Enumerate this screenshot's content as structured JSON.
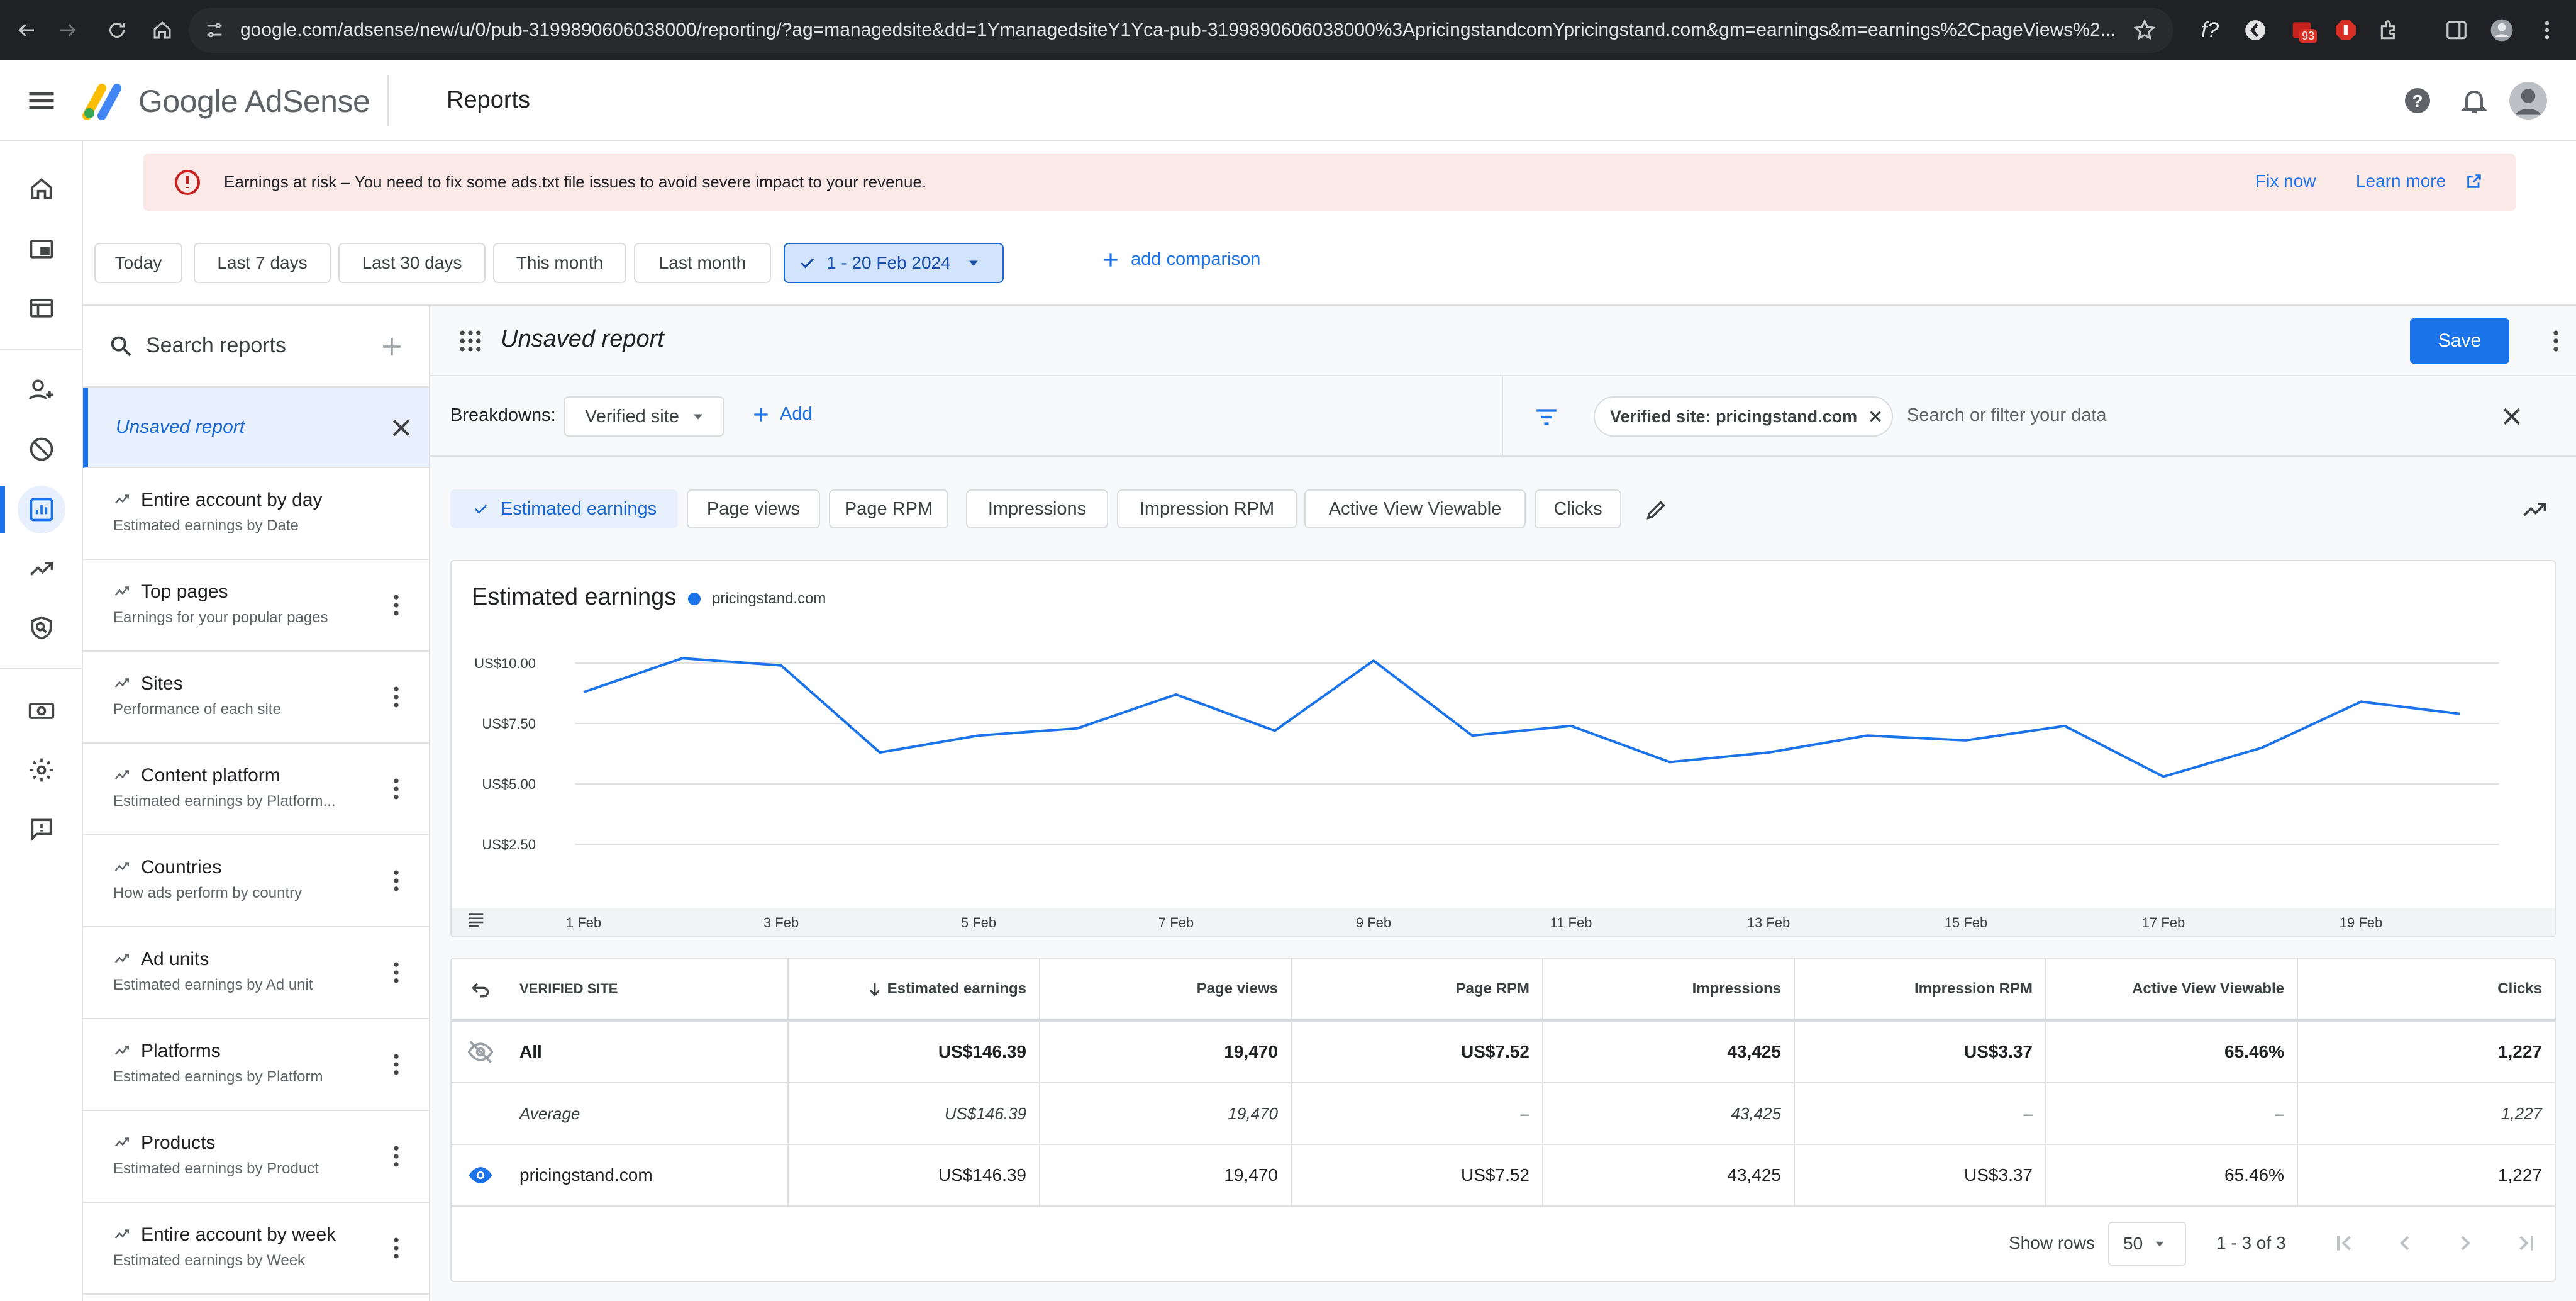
{
  "browser": {
    "url": "google.com/adsense/new/u/0/pub-3199890606038000/reporting/?ag=managedsite&dd=1YmanagedsiteY1Yca-pub-3199890606038000%3ApricingstandcomYpricingstand.com&gm=earnings&m=earnings%2CpageViews%2...",
    "extension_badge": "93"
  },
  "app": {
    "brand": "Google AdSense",
    "page_title": "Reports"
  },
  "banner": {
    "message": "Earnings at risk – You need to fix some ads.txt file issues to avoid severe impact to your revenue.",
    "fix_now": "Fix now",
    "learn_more": "Learn more"
  },
  "date_range": {
    "chips": [
      "Today",
      "Last 7 days",
      "Last 30 days",
      "This month",
      "Last month"
    ],
    "selected": "1 - 20 Feb 2024",
    "add_comparison": "add comparison"
  },
  "report_list": {
    "search_placeholder": "Search reports",
    "current": "Unsaved report",
    "items": [
      {
        "title": "Entire account by day",
        "subtitle": "Estimated earnings by Date"
      },
      {
        "title": "Top pages",
        "subtitle": "Earnings for your popular pages"
      },
      {
        "title": "Sites",
        "subtitle": "Performance of each site"
      },
      {
        "title": "Content platform",
        "subtitle": "Estimated earnings by Platform..."
      },
      {
        "title": "Countries",
        "subtitle": "How ads perform by country"
      },
      {
        "title": "Ad units",
        "subtitle": "Estimated earnings by Ad unit"
      },
      {
        "title": "Platforms",
        "subtitle": "Estimated earnings by Platform"
      },
      {
        "title": "Products",
        "subtitle": "Estimated earnings by Product"
      },
      {
        "title": "Entire account by week",
        "subtitle": "Estimated earnings by Week"
      }
    ]
  },
  "report": {
    "title": "Unsaved report",
    "save": "Save",
    "breakdowns_label": "Breakdowns:",
    "breakdown_value": "Verified site",
    "add": "Add",
    "filter_chip": "Verified site: pricingstand.com",
    "filter_placeholder": "Search or filter your data",
    "metrics": [
      "Estimated earnings",
      "Page views",
      "Page RPM",
      "Impressions",
      "Impression RPM",
      "Active View Viewable",
      "Clicks"
    ],
    "selected_metric": "Estimated earnings"
  },
  "chart_data": {
    "type": "line",
    "title": "Estimated earnings",
    "series": [
      {
        "name": "pricingstand.com",
        "color": "#1a73e8",
        "values": [
          8.8,
          10.2,
          9.9,
          6.3,
          7.0,
          7.3,
          8.7,
          7.2,
          10.1,
          7.0,
          7.4,
          5.9,
          6.3,
          7.0,
          6.8,
          7.4,
          5.3,
          6.5,
          8.4,
          7.9
        ]
      }
    ],
    "x": [
      "1 Feb",
      "2 Feb",
      "3 Feb",
      "4 Feb",
      "5 Feb",
      "6 Feb",
      "7 Feb",
      "8 Feb",
      "9 Feb",
      "10 Feb",
      "11 Feb",
      "12 Feb",
      "13 Feb",
      "14 Feb",
      "15 Feb",
      "16 Feb",
      "17 Feb",
      "18 Feb",
      "19 Feb",
      "20 Feb"
    ],
    "x_tick_labels": [
      "1 Feb",
      "3 Feb",
      "5 Feb",
      "7 Feb",
      "9 Feb",
      "11 Feb",
      "13 Feb",
      "15 Feb",
      "17 Feb",
      "19 Feb"
    ],
    "y_tick_labels": [
      "US$10.00",
      "US$7.50",
      "US$5.00",
      "US$2.50"
    ],
    "y_ticks": [
      10,
      7.5,
      5,
      2.5
    ],
    "ylim": [
      0,
      10
    ],
    "grid": true
  },
  "table": {
    "headers": [
      "VERIFIED SITE",
      "Estimated earnings",
      "Page views",
      "Page RPM",
      "Impressions",
      "Impression RPM",
      "Active View Viewable",
      "Clicks"
    ],
    "rows": [
      {
        "cells": [
          "All",
          "US$146.39",
          "19,470",
          "US$7.52",
          "43,425",
          "US$3.37",
          "65.46%",
          "1,227"
        ]
      },
      {
        "cells": [
          "Average",
          "US$146.39",
          "19,470",
          "–",
          "43,425",
          "–",
          "–",
          "1,227"
        ]
      },
      {
        "cells": [
          "pricingstand.com",
          "US$146.39",
          "19,470",
          "US$7.52",
          "43,425",
          "US$3.37",
          "65.46%",
          "1,227"
        ]
      }
    ],
    "show_rows_label": "Show rows",
    "rows_per_page": "50",
    "range": "1 - 3 of 3"
  }
}
